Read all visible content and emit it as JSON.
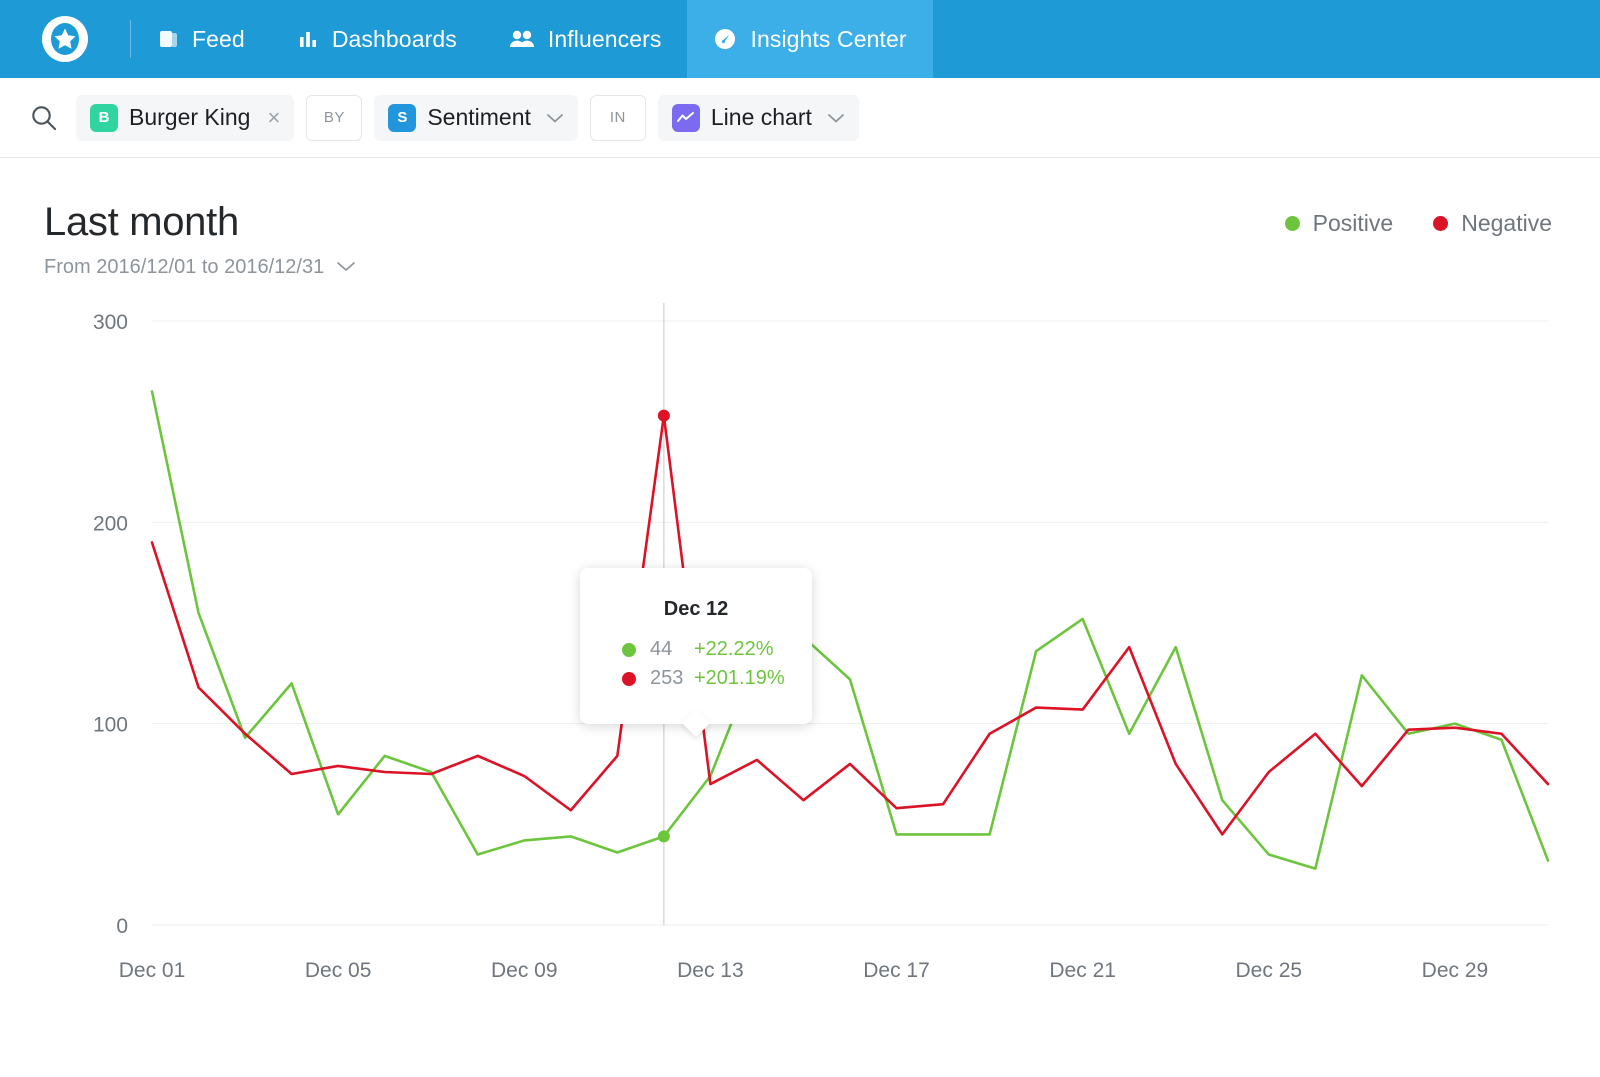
{
  "nav": {
    "logo": "star-logo",
    "items": [
      {
        "label": "Feed",
        "icon": "feed-icon",
        "active": false
      },
      {
        "label": "Dashboards",
        "icon": "bar-chart-icon",
        "active": false
      },
      {
        "label": "Influencers",
        "icon": "people-icon",
        "active": false
      },
      {
        "label": "Insights Center",
        "icon": "gauge-icon",
        "active": true
      }
    ]
  },
  "filters": {
    "search_icon": "search-icon",
    "subject": {
      "badge": "B",
      "badge_color": "#2fd4a0",
      "label": "Burger King",
      "remove": "×"
    },
    "conj_by": "BY",
    "metric": {
      "badge": "S",
      "badge_color": "#2196dd",
      "label": "Sentiment"
    },
    "conj_in": "IN",
    "viz": {
      "badge": "chart-line-icon",
      "badge_color": "#7c6af0",
      "label": "Line chart"
    }
  },
  "header": {
    "title": "Last month",
    "date_range": "From 2016/12/01 to 2016/12/31"
  },
  "legend": [
    {
      "label": "Positive",
      "color": "#6dc53e"
    },
    {
      "label": "Negative",
      "color": "#dc1226"
    }
  ],
  "tooltip": {
    "title": "Dec 12",
    "rows": [
      {
        "color": "#6dc53e",
        "value": "44",
        "pct": "+22.22%"
      },
      {
        "color": "#dc1226",
        "value": "253",
        "pct": "+201.19%"
      }
    ]
  },
  "chart_data": {
    "type": "line",
    "title": "Last month",
    "xlabel": "",
    "ylabel": "",
    "ylim": [
      0,
      300
    ],
    "yticks": [
      0,
      100,
      200,
      300
    ],
    "grid": true,
    "legend_position": "top-right",
    "x_tick_labels": [
      "Dec 01",
      "Dec 05",
      "Dec 09",
      "Dec 13",
      "Dec 17",
      "Dec 21",
      "Dec 25",
      "Dec 29"
    ],
    "x_tick_indices": [
      0,
      4,
      8,
      12,
      16,
      20,
      24,
      28
    ],
    "categories": [
      "Dec 01",
      "Dec 02",
      "Dec 03",
      "Dec 04",
      "Dec 05",
      "Dec 06",
      "Dec 07",
      "Dec 08",
      "Dec 09",
      "Dec 10",
      "Dec 11",
      "Dec 12",
      "Dec 13",
      "Dec 14",
      "Dec 15",
      "Dec 16",
      "Dec 17",
      "Dec 18",
      "Dec 19",
      "Dec 20",
      "Dec 21",
      "Dec 22",
      "Dec 23",
      "Dec 24",
      "Dec 25",
      "Dec 26",
      "Dec 27",
      "Dec 28",
      "Dec 29",
      "Dec 30",
      "Dec 31"
    ],
    "series": [
      {
        "name": "Positive",
        "color": "#6dc53e",
        "values": [
          265,
          155,
          93,
          120,
          55,
          84,
          76,
          35,
          42,
          44,
          36,
          44,
          74,
          132,
          143,
          122,
          45,
          45,
          45,
          136,
          152,
          95,
          138,
          62,
          35,
          28,
          124,
          95,
          100,
          92,
          32
        ]
      },
      {
        "name": "Negative",
        "color": "#dc1226",
        "values": [
          190,
          118,
          95,
          75,
          79,
          76,
          75,
          84,
          74,
          57,
          84,
          253,
          70,
          82,
          62,
          80,
          58,
          60,
          95,
          108,
          107,
          138,
          80,
          45,
          76,
          95,
          69,
          97,
          98,
          95,
          70
        ]
      }
    ],
    "highlight_index": 11
  }
}
